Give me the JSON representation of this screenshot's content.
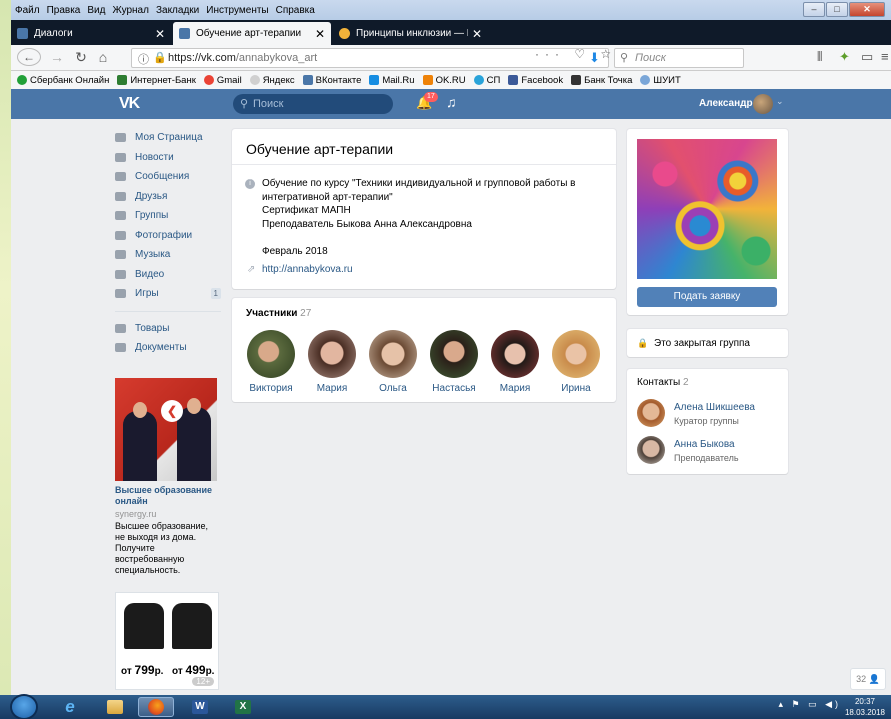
{
  "menubar": {
    "items": [
      "Файл",
      "Правка",
      "Вид",
      "Журнал",
      "Закладки",
      "Инструменты",
      "Справка"
    ]
  },
  "tabs": [
    {
      "label": "Диалоги",
      "close": "✕"
    },
    {
      "label": "Обучение арт-терапии",
      "close": "✕"
    },
    {
      "label": "Принципы инклюзии — Нау...",
      "close": "✕"
    }
  ],
  "newtab": "+",
  "nav": {
    "url_host": "https://vk.com",
    "url_path": "/annabykova_art",
    "search_placeholder": "Поиск",
    "url_icons": "··· ♡ ☆"
  },
  "bookmarks": [
    {
      "label": "Сбербанк Онлайн",
      "color": "#21a038"
    },
    {
      "label": "Интернет-Банк",
      "color": "#2e7d32"
    },
    {
      "label": "Gmail",
      "color": "#ea4335"
    },
    {
      "label": "Яндекс",
      "color": "#d0d0d0"
    },
    {
      "label": "ВКонтакте",
      "color": "#4a76a8"
    },
    {
      "label": "Mail.Ru",
      "color": "#168de2"
    },
    {
      "label": "OK.RU",
      "color": "#ee8208"
    },
    {
      "label": "СП",
      "color": "#29a3d9"
    },
    {
      "label": "Facebook",
      "color": "#3b5998"
    },
    {
      "label": "Банк Точка",
      "color": "#333333"
    },
    {
      "label": "ШУИТ",
      "color": "#7aa6d8"
    }
  ],
  "vk": {
    "logo": "VK",
    "search_placeholder": "Поиск",
    "notif_count": "17",
    "user_name": "Александр"
  },
  "leftmenu": {
    "items": [
      {
        "label": "Моя Страница",
        "icon": "home-icon"
      },
      {
        "label": "Новости",
        "icon": "news-icon"
      },
      {
        "label": "Сообщения",
        "icon": "messages-icon"
      },
      {
        "label": "Друзья",
        "icon": "friends-icon"
      },
      {
        "label": "Группы",
        "icon": "groups-icon"
      },
      {
        "label": "Фотографии",
        "icon": "photos-icon"
      },
      {
        "label": "Музыка",
        "icon": "music-icon"
      },
      {
        "label": "Видео",
        "icon": "video-icon"
      },
      {
        "label": "Игры",
        "icon": "games-icon",
        "count": "1"
      }
    ],
    "items2": [
      {
        "label": "Товары",
        "icon": "goods-icon"
      },
      {
        "label": "Документы",
        "icon": "documents-icon"
      }
    ]
  },
  "ad1": {
    "title": "Высшее образование онлайн",
    "site": "synergy.ru",
    "text": "Высшее образование, не выходя из дома. Получите востребованную специальность."
  },
  "ad2": {
    "price1_prefix": "от",
    "price1": "799",
    "price1_suffix": "р.",
    "price2_prefix": "от",
    "price2": "499",
    "price2_suffix": "р.",
    "count": "12+"
  },
  "group": {
    "title": "Обучение арт-терапии",
    "desc_lines": [
      "Обучение по курсу \"Техники индивидуальной и групповой работы в",
      "интегративной арт-терапии\"",
      "Сертификат МАПН",
      "Преподаватель Быкова Анна Александровна"
    ],
    "date": "Февраль 2018",
    "link": "http://annabykova.ru"
  },
  "members": {
    "header": "Участники",
    "count": "27",
    "list": [
      {
        "name": "Виктория"
      },
      {
        "name": "Мария"
      },
      {
        "name": "Ольга"
      },
      {
        "name": "Настасья"
      },
      {
        "name": "Мария"
      },
      {
        "name": "Ирина"
      }
    ]
  },
  "right": {
    "join_button": "Подать заявку",
    "closed_text": "Это закрытая группа",
    "contacts_header": "Контакты",
    "contacts_count": "2",
    "contacts": [
      {
        "name": "Алена Шикшеева",
        "role": "Куратор группы"
      },
      {
        "name": "Анна Быкова",
        "role": "Преподаватель"
      }
    ]
  },
  "online": "32",
  "taskbar": {
    "time": "20:37",
    "date": "18.03.2018",
    "word": "W",
    "excel": "X"
  }
}
